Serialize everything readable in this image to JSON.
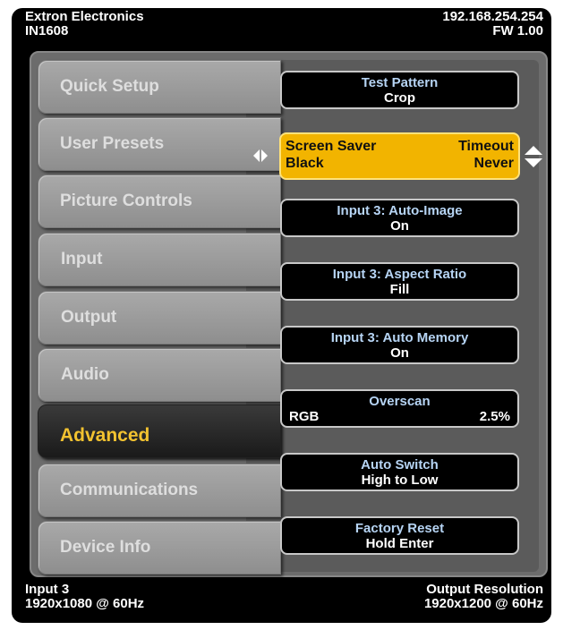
{
  "header": {
    "brand": "Extron Electronics",
    "model": "IN1608",
    "ip": "192.168.254.254",
    "firmware": "FW 1.00"
  },
  "menu": {
    "items": [
      {
        "label": "Quick Setup"
      },
      {
        "label": "User Presets"
      },
      {
        "label": "Picture Controls"
      },
      {
        "label": "Input"
      },
      {
        "label": "Output"
      },
      {
        "label": "Audio"
      },
      {
        "label": "Advanced"
      },
      {
        "label": "Communications"
      },
      {
        "label": "Device Info"
      }
    ],
    "active": "Advanced"
  },
  "settings": {
    "test_pattern": {
      "title": "Test Pattern",
      "value": "Crop"
    },
    "screen_saver": {
      "title": "Screen Saver",
      "title_right": "Timeout",
      "value": "Black",
      "value_right": "Never"
    },
    "auto_image": {
      "title": "Input 3: Auto-Image",
      "value": "On"
    },
    "aspect_ratio": {
      "title": "Input 3: Aspect Ratio",
      "value": "Fill"
    },
    "auto_memory": {
      "title": "Input 3: Auto Memory",
      "value": "On"
    },
    "overscan": {
      "title": "Overscan",
      "value_left": "RGB",
      "value_right": "2.5%"
    },
    "auto_switch": {
      "title": "Auto Switch",
      "value": "High to Low"
    },
    "factory_reset": {
      "title": "Factory Reset",
      "value": "Hold Enter"
    }
  },
  "footer": {
    "input_label": "Input 3",
    "input_resolution": "1920x1080 @ 60Hz",
    "output_label": "Output Resolution",
    "output_resolution": "1920x1200 @ 60Hz"
  },
  "colors": {
    "accent": "#f2b400",
    "active_tab_text": "#f2c230",
    "button_title": "#b6d4f4"
  }
}
